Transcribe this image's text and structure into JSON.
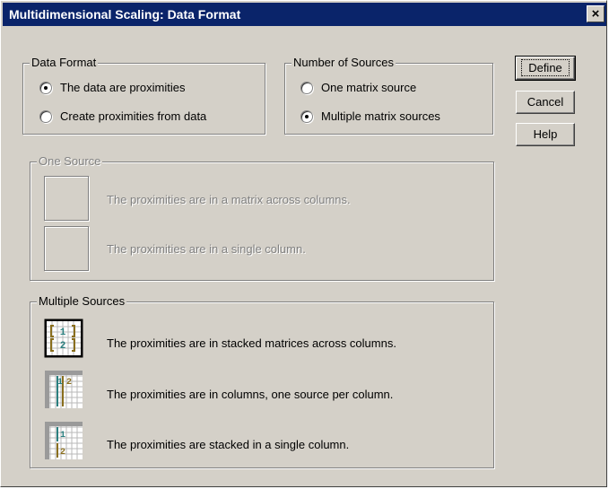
{
  "window": {
    "title": "Multidimensional Scaling: Data Format",
    "close_glyph": "×"
  },
  "data_format": {
    "legend": "Data Format",
    "options": [
      {
        "label": "The data are proximities",
        "checked": true
      },
      {
        "label": "Create proximities from data",
        "checked": false
      }
    ]
  },
  "number_of_sources": {
    "legend": "Number of Sources",
    "options": [
      {
        "label": "One matrix source",
        "checked": false
      },
      {
        "label": "Multiple matrix sources",
        "checked": true
      }
    ]
  },
  "buttons": {
    "define": "Define",
    "cancel": "Cancel",
    "help": "Help"
  },
  "one_source": {
    "legend": "One Source",
    "enabled": false,
    "options": [
      {
        "label": "The proximities are in a matrix across columns.",
        "icon": "blank-icon"
      },
      {
        "label": "The proximities are in a single column.",
        "icon": "blank-icon"
      }
    ]
  },
  "multiple_sources": {
    "legend": "Multiple Sources",
    "options": [
      {
        "label": "The proximities are in stacked matrices across columns.",
        "icon": "stacked-matrices-icon",
        "selected": true,
        "glyphs": [
          "1",
          "2"
        ]
      },
      {
        "label": "The proximities are in columns, one source per column.",
        "icon": "columns-per-source-icon",
        "selected": false,
        "glyphs": [
          "1",
          "2"
        ]
      },
      {
        "label": "The proximities are stacked in a single column.",
        "icon": "stacked-single-column-icon",
        "selected": false,
        "glyphs": [
          "1",
          "2"
        ]
      }
    ]
  },
  "colors": {
    "title_bar": "#0a246a",
    "dialog_face": "#d4d0c8",
    "disabled_text": "#808080",
    "icon_teal": "#2a7f7f",
    "icon_olive": "#8a6f1e"
  }
}
